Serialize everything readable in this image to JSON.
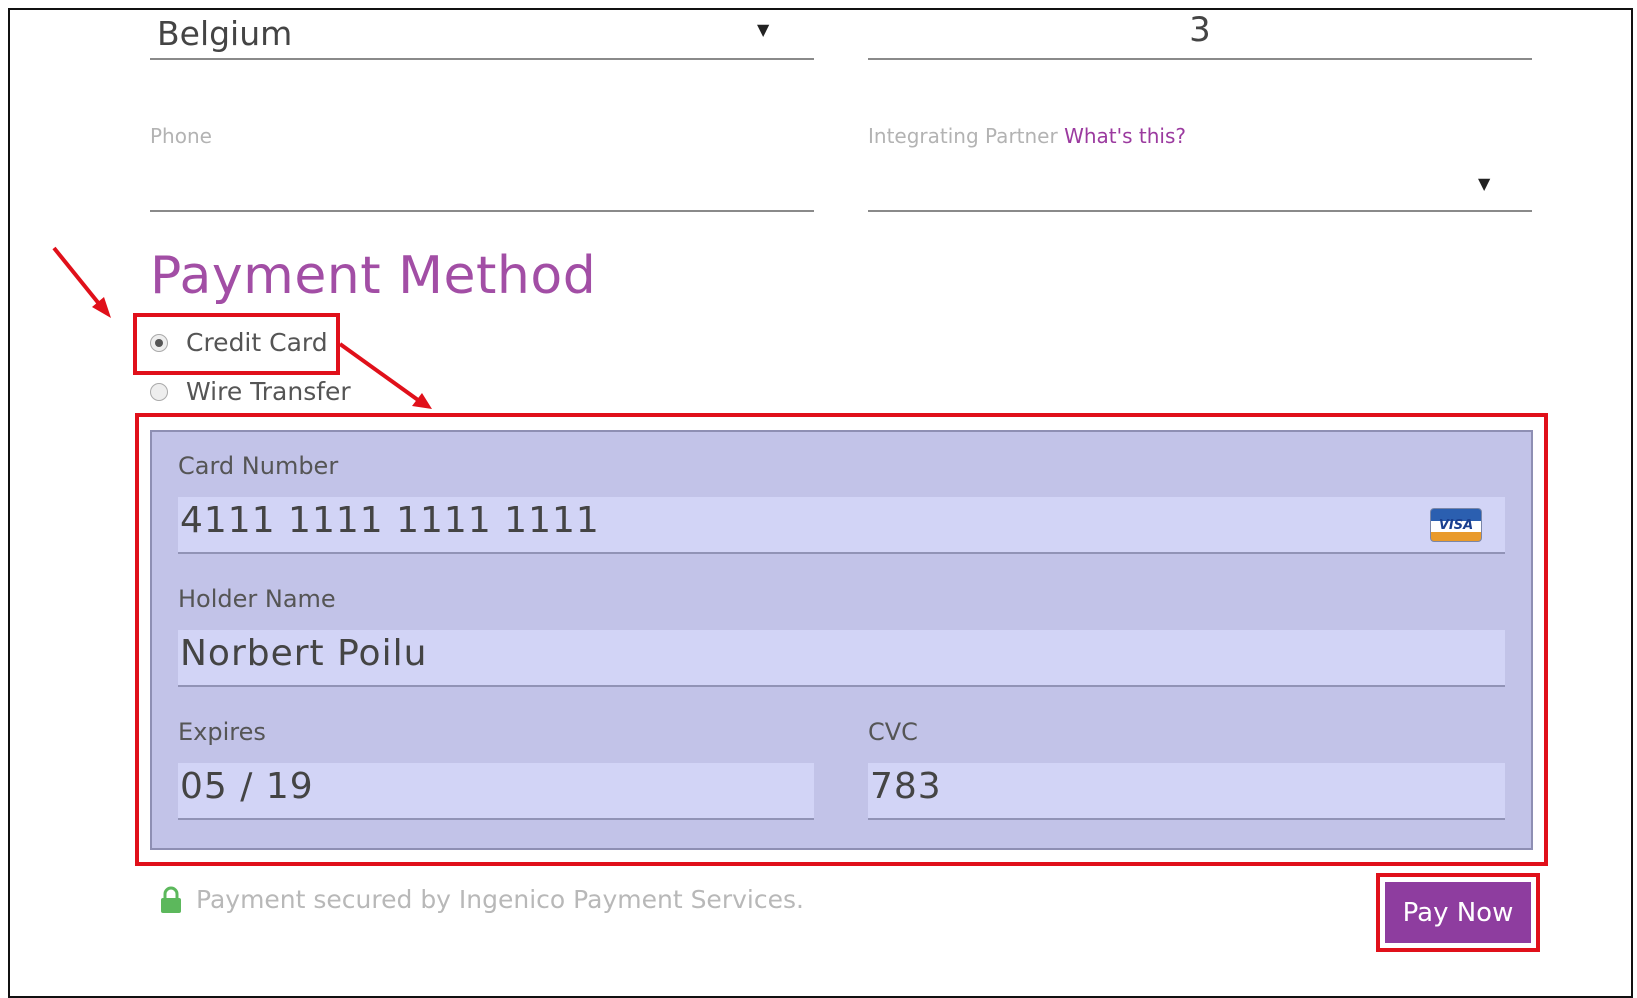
{
  "address": {
    "country_value": "Belgium",
    "quantity_value": "3"
  },
  "contact": {
    "phone_label": "Phone",
    "phone_value": "",
    "partner_label": "Integrating Partner",
    "partner_link": "What's this?",
    "partner_value": ""
  },
  "payment": {
    "title": "Payment Method",
    "options": [
      {
        "label": "Credit Card",
        "selected": true
      },
      {
        "label": "Wire Transfer",
        "selected": false
      }
    ],
    "card": {
      "card_number_label": "Card Number",
      "card_number_value": "4111 1111 1111 1111",
      "card_brand": "VISA",
      "holder_label": "Holder Name",
      "holder_value": "Norbert Poilu",
      "expires_label": "Expires",
      "expires_value": "05 / 19",
      "cvc_label": "CVC",
      "cvc_value": "783"
    },
    "secure_text": "Payment secured by Ingenico Payment Services.",
    "pay_button": "Pay Now"
  },
  "colors": {
    "accent": "#a24ea5",
    "button": "#8e3d9f",
    "panel": "#c2c3e8",
    "annotation": "#e0101a",
    "lock": "#5cb85c"
  },
  "icons": [
    "dropdown-caret-icon",
    "visa-card-icon",
    "lock-icon",
    "annotation-arrow-icon"
  ]
}
